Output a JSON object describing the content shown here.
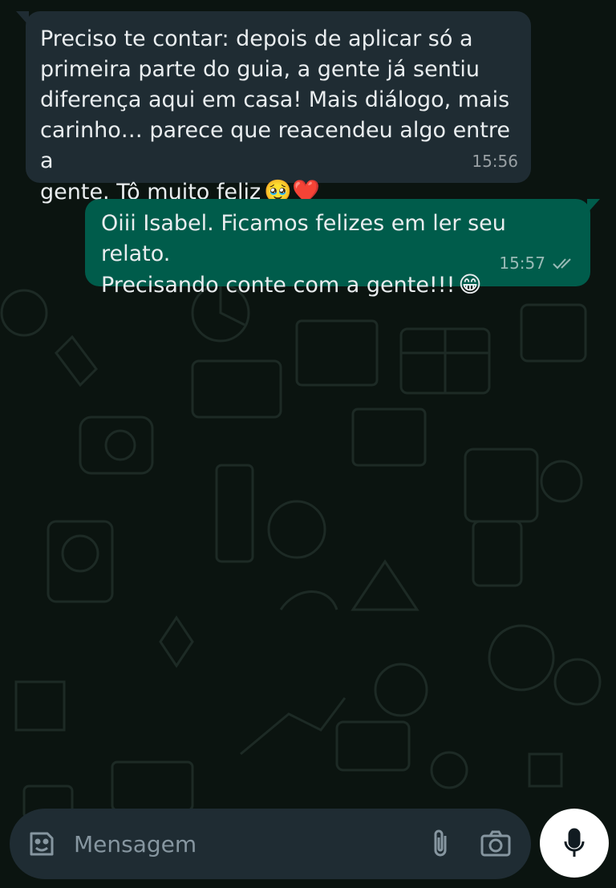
{
  "chat": {
    "messages": [
      {
        "direction": "incoming",
        "text": "Preciso te contar: depois de aplicar só a\nprimeira parte do guia, a gente já sentiu\ndiferença aqui em casa! Mais diálogo, mais\ncarinho… parece que reacendeu algo entre a\ngente. Tô muito feliz",
        "emoji": "🥹❤️",
        "time": "15:56"
      },
      {
        "direction": "outgoing",
        "text": "Oiii Isabel. Ficamos felizes em ler seu relato.\nPrecisando conte com a gente!!!",
        "emoji": "😁",
        "time": "15:57",
        "status": "read"
      }
    ]
  },
  "composer": {
    "placeholder": "Mensagem",
    "icons": [
      "sticker-icon",
      "paperclip-icon",
      "camera-icon",
      "microphone-icon"
    ]
  },
  "colors": {
    "background": "#0b1410",
    "incoming_bubble": "#1f2c33",
    "outgoing_bubble": "#005c4b",
    "mic_button": "#ffffff"
  }
}
